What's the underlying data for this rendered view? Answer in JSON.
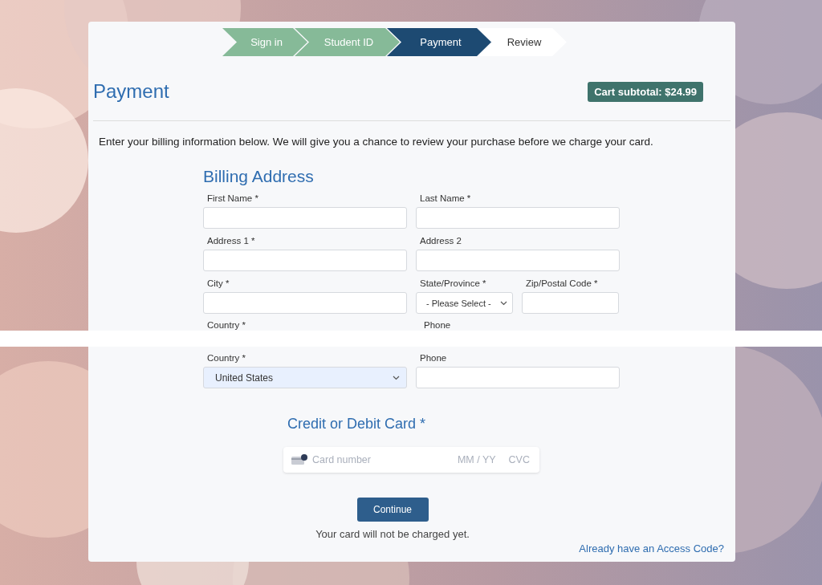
{
  "steps": [
    {
      "label": "Sign in",
      "completed": true,
      "selected": false
    },
    {
      "label": "Student ID",
      "completed": true,
      "selected": false
    },
    {
      "label": "Payment",
      "completed": false,
      "selected": true
    },
    {
      "label": "Review",
      "completed": false,
      "selected": false
    }
  ],
  "page_title": "Payment",
  "cart_subtotal": "Cart subtotal: $24.99",
  "intro": "Enter your billing information below. We will give you a chance to review your purchase before we charge your card.",
  "billing": {
    "title": "Billing Address",
    "rows": [
      [
        {
          "label": "First Name *",
          "kind": "text"
        },
        {
          "label": "Last Name *",
          "kind": "text"
        }
      ],
      [
        {
          "label": "Address 1 *",
          "kind": "text"
        },
        {
          "label": "Address 2",
          "kind": "text"
        }
      ],
      [
        {
          "label": "City *",
          "kind": "text"
        },
        {
          "label": "State/Province *",
          "kind": "select",
          "value": "- Please Select -"
        },
        {
          "label": "Zip/Postal Code *",
          "kind": "text"
        }
      ]
    ],
    "seam_labels": [
      "Country *",
      "Phone"
    ],
    "last_row": [
      {
        "label": "Country *",
        "kind": "select",
        "value": "United States",
        "autofilled": true
      },
      {
        "label": "Phone",
        "kind": "text"
      }
    ]
  },
  "card": {
    "title": "Credit or Debit Card *",
    "number_placeholder": "Card number",
    "expiry_placeholder": "MM / YY",
    "cvc_placeholder": "CVC"
  },
  "continue_button": "Continue",
  "note": "Your card will not be charged yet.",
  "access_code_link": "Already have an Access Code?"
}
